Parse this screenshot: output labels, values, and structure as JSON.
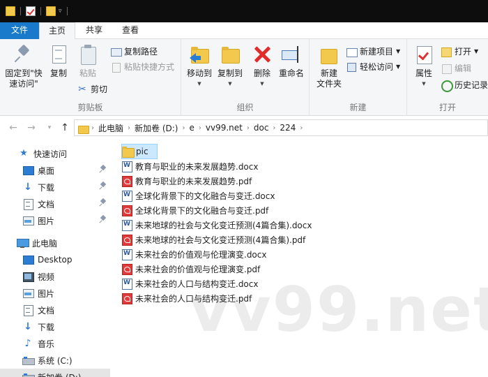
{
  "tabs": {
    "file": "文件",
    "home": "主页",
    "share": "共享",
    "view": "查看"
  },
  "ribbon": {
    "clipboard": {
      "group_label": "剪贴板",
      "pin_label_line1": "固定到\"快",
      "pin_label_line2": "速访问\"",
      "copy_label": "复制",
      "paste_label": "粘贴",
      "copy_path_label": "复制路径",
      "paste_shortcut_label": "粘贴快捷方式",
      "cut_label": "剪切"
    },
    "organize": {
      "group_label": "组织",
      "move_to_label": "移动到",
      "copy_to_label": "复制到",
      "delete_label": "删除",
      "rename_label": "重命名"
    },
    "new": {
      "group_label": "新建",
      "new_folder_line1": "新建",
      "new_folder_line2": "文件夹",
      "new_item_label": "新建项目",
      "easy_access_label": "轻松访问"
    },
    "open": {
      "group_label": "打开",
      "properties_label": "属性",
      "open_label": "打开",
      "edit_label": "编辑",
      "history_label": "历史记录"
    }
  },
  "address": {
    "crumbs": [
      "此电脑",
      "新加卷 (D:)",
      "e",
      "vv99.net",
      "doc",
      "224"
    ]
  },
  "nav": {
    "quick_access": "快速访问",
    "desktop": "桌面",
    "downloads": "下载",
    "documents": "文档",
    "pictures": "图片",
    "this_pc": "此电脑",
    "pc_desktop": "Desktop",
    "pc_videos": "视频",
    "pc_pictures": "图片",
    "pc_documents": "文档",
    "pc_downloads": "下载",
    "pc_music": "音乐",
    "drive_c": "系统 (C:)",
    "drive_d": "新加卷 (D:)"
  },
  "files": [
    {
      "name": "pic",
      "type": "folder"
    },
    {
      "name": "教育与职业的未来发展趋势.docx",
      "type": "docx"
    },
    {
      "name": "教育与职业的未来发展趋势.pdf",
      "type": "pdf"
    },
    {
      "name": "全球化背景下的文化融合与变迁.docx",
      "type": "docx"
    },
    {
      "name": "全球化背景下的文化融合与变迁.pdf",
      "type": "pdf"
    },
    {
      "name": "未来地球的社会与文化变迁预测(4篇合集).docx",
      "type": "docx"
    },
    {
      "name": "未来地球的社会与文化变迁预测(4篇合集).pdf",
      "type": "pdf"
    },
    {
      "name": "未来社会的价值观与伦理演变.docx",
      "type": "docx"
    },
    {
      "name": "未来社会的价值观与伦理演变.pdf",
      "type": "pdf"
    },
    {
      "name": "未来社会的人口与结构变迁.docx",
      "type": "docx"
    },
    {
      "name": "未来社会的人口与结构变迁.pdf",
      "type": "pdf"
    }
  ],
  "watermark": "vv99.net"
}
